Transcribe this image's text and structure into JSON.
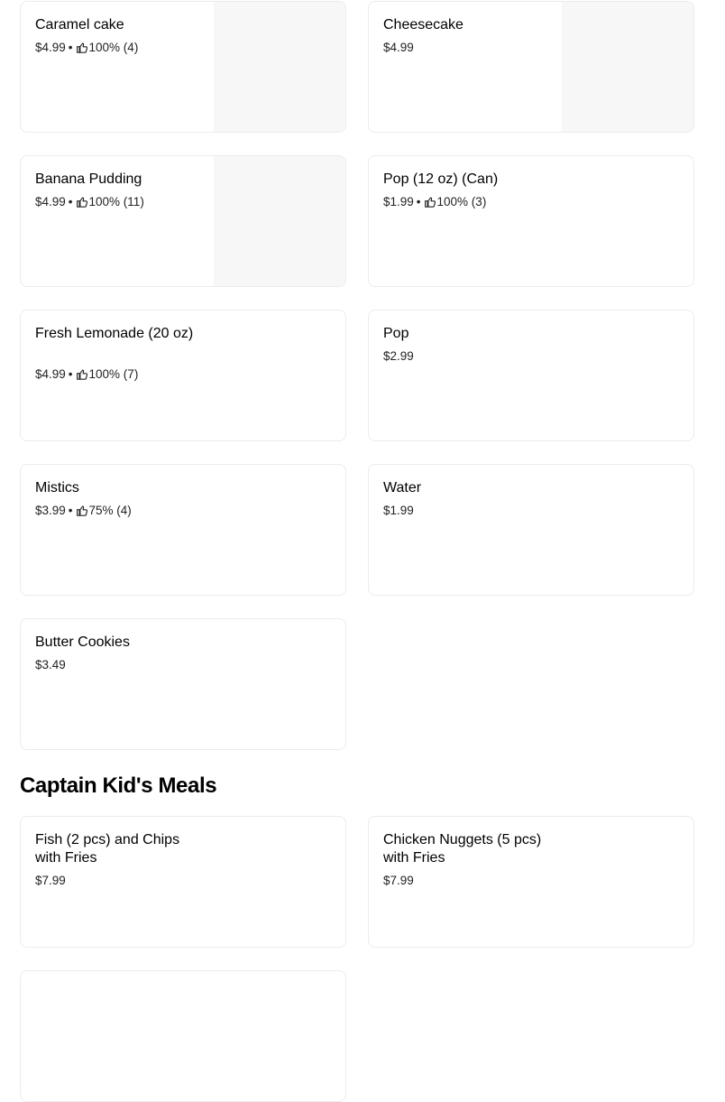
{
  "items": [
    {
      "name": "Caramel cake",
      "price": "$4.99",
      "rating": "100% (4)"
    },
    {
      "name": "Cheesecake",
      "price": "$4.99"
    },
    {
      "name": "Banana Pudding",
      "price": "$4.99",
      "rating": "100% (11)"
    },
    {
      "name": "Pop (12 oz) (Can)",
      "price": "$1.99",
      "rating": "100% (3)"
    },
    {
      "name": "Fresh Lemonade  (20 oz)",
      "price": "$4.99",
      "rating": "100% (7)"
    },
    {
      "name": "Pop",
      "price": "$2.99"
    },
    {
      "name": "Mistics",
      "price": "$3.99",
      "rating": "75% (4)"
    },
    {
      "name": "Water",
      "price": "$1.99"
    },
    {
      "name": "Butter Cookies",
      "price": "$3.49"
    }
  ],
  "section": {
    "title": "Captain Kid's Meals"
  },
  "kids_items": [
    {
      "name": "Fish (2 pcs) and Chips with Fries",
      "price": "$7.99"
    },
    {
      "name": "Chicken Nuggets (5 pcs) with Fries",
      "price": "$7.99"
    }
  ],
  "separator": "•",
  "icons": {
    "rating": "thumbs-up-icon"
  }
}
